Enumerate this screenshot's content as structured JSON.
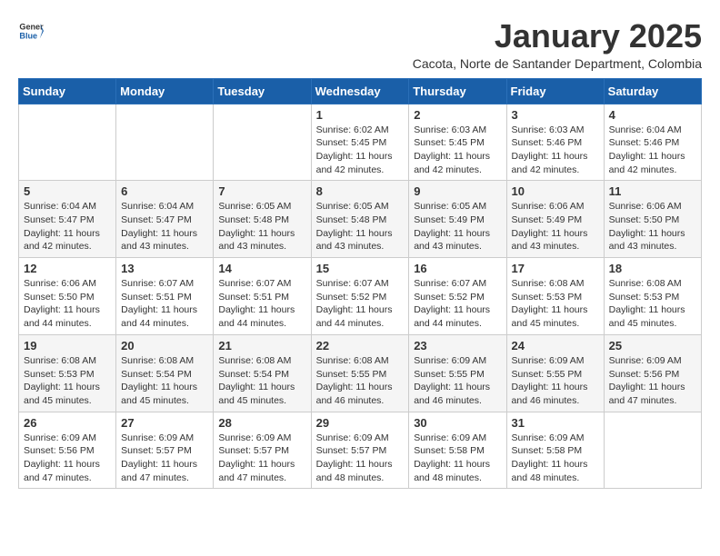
{
  "logo": {
    "general": "General",
    "blue": "Blue"
  },
  "title": "January 2025",
  "subtitle": "Cacota, Norte de Santander Department, Colombia",
  "days_of_week": [
    "Sunday",
    "Monday",
    "Tuesday",
    "Wednesday",
    "Thursday",
    "Friday",
    "Saturday"
  ],
  "weeks": [
    [
      {
        "day": "",
        "info": ""
      },
      {
        "day": "",
        "info": ""
      },
      {
        "day": "",
        "info": ""
      },
      {
        "day": "1",
        "info": "Sunrise: 6:02 AM\nSunset: 5:45 PM\nDaylight: 11 hours and 42 minutes."
      },
      {
        "day": "2",
        "info": "Sunrise: 6:03 AM\nSunset: 5:45 PM\nDaylight: 11 hours and 42 minutes."
      },
      {
        "day": "3",
        "info": "Sunrise: 6:03 AM\nSunset: 5:46 PM\nDaylight: 11 hours and 42 minutes."
      },
      {
        "day": "4",
        "info": "Sunrise: 6:04 AM\nSunset: 5:46 PM\nDaylight: 11 hours and 42 minutes."
      }
    ],
    [
      {
        "day": "5",
        "info": "Sunrise: 6:04 AM\nSunset: 5:47 PM\nDaylight: 11 hours and 42 minutes."
      },
      {
        "day": "6",
        "info": "Sunrise: 6:04 AM\nSunset: 5:47 PM\nDaylight: 11 hours and 43 minutes."
      },
      {
        "day": "7",
        "info": "Sunrise: 6:05 AM\nSunset: 5:48 PM\nDaylight: 11 hours and 43 minutes."
      },
      {
        "day": "8",
        "info": "Sunrise: 6:05 AM\nSunset: 5:48 PM\nDaylight: 11 hours and 43 minutes."
      },
      {
        "day": "9",
        "info": "Sunrise: 6:05 AM\nSunset: 5:49 PM\nDaylight: 11 hours and 43 minutes."
      },
      {
        "day": "10",
        "info": "Sunrise: 6:06 AM\nSunset: 5:49 PM\nDaylight: 11 hours and 43 minutes."
      },
      {
        "day": "11",
        "info": "Sunrise: 6:06 AM\nSunset: 5:50 PM\nDaylight: 11 hours and 43 minutes."
      }
    ],
    [
      {
        "day": "12",
        "info": "Sunrise: 6:06 AM\nSunset: 5:50 PM\nDaylight: 11 hours and 44 minutes."
      },
      {
        "day": "13",
        "info": "Sunrise: 6:07 AM\nSunset: 5:51 PM\nDaylight: 11 hours and 44 minutes."
      },
      {
        "day": "14",
        "info": "Sunrise: 6:07 AM\nSunset: 5:51 PM\nDaylight: 11 hours and 44 minutes."
      },
      {
        "day": "15",
        "info": "Sunrise: 6:07 AM\nSunset: 5:52 PM\nDaylight: 11 hours and 44 minutes."
      },
      {
        "day": "16",
        "info": "Sunrise: 6:07 AM\nSunset: 5:52 PM\nDaylight: 11 hours and 44 minutes."
      },
      {
        "day": "17",
        "info": "Sunrise: 6:08 AM\nSunset: 5:53 PM\nDaylight: 11 hours and 45 minutes."
      },
      {
        "day": "18",
        "info": "Sunrise: 6:08 AM\nSunset: 5:53 PM\nDaylight: 11 hours and 45 minutes."
      }
    ],
    [
      {
        "day": "19",
        "info": "Sunrise: 6:08 AM\nSunset: 5:53 PM\nDaylight: 11 hours and 45 minutes."
      },
      {
        "day": "20",
        "info": "Sunrise: 6:08 AM\nSunset: 5:54 PM\nDaylight: 11 hours and 45 minutes."
      },
      {
        "day": "21",
        "info": "Sunrise: 6:08 AM\nSunset: 5:54 PM\nDaylight: 11 hours and 45 minutes."
      },
      {
        "day": "22",
        "info": "Sunrise: 6:08 AM\nSunset: 5:55 PM\nDaylight: 11 hours and 46 minutes."
      },
      {
        "day": "23",
        "info": "Sunrise: 6:09 AM\nSunset: 5:55 PM\nDaylight: 11 hours and 46 minutes."
      },
      {
        "day": "24",
        "info": "Sunrise: 6:09 AM\nSunset: 5:55 PM\nDaylight: 11 hours and 46 minutes."
      },
      {
        "day": "25",
        "info": "Sunrise: 6:09 AM\nSunset: 5:56 PM\nDaylight: 11 hours and 47 minutes."
      }
    ],
    [
      {
        "day": "26",
        "info": "Sunrise: 6:09 AM\nSunset: 5:56 PM\nDaylight: 11 hours and 47 minutes."
      },
      {
        "day": "27",
        "info": "Sunrise: 6:09 AM\nSunset: 5:57 PM\nDaylight: 11 hours and 47 minutes."
      },
      {
        "day": "28",
        "info": "Sunrise: 6:09 AM\nSunset: 5:57 PM\nDaylight: 11 hours and 47 minutes."
      },
      {
        "day": "29",
        "info": "Sunrise: 6:09 AM\nSunset: 5:57 PM\nDaylight: 11 hours and 48 minutes."
      },
      {
        "day": "30",
        "info": "Sunrise: 6:09 AM\nSunset: 5:58 PM\nDaylight: 11 hours and 48 minutes."
      },
      {
        "day": "31",
        "info": "Sunrise: 6:09 AM\nSunset: 5:58 PM\nDaylight: 11 hours and 48 minutes."
      },
      {
        "day": "",
        "info": ""
      }
    ]
  ]
}
